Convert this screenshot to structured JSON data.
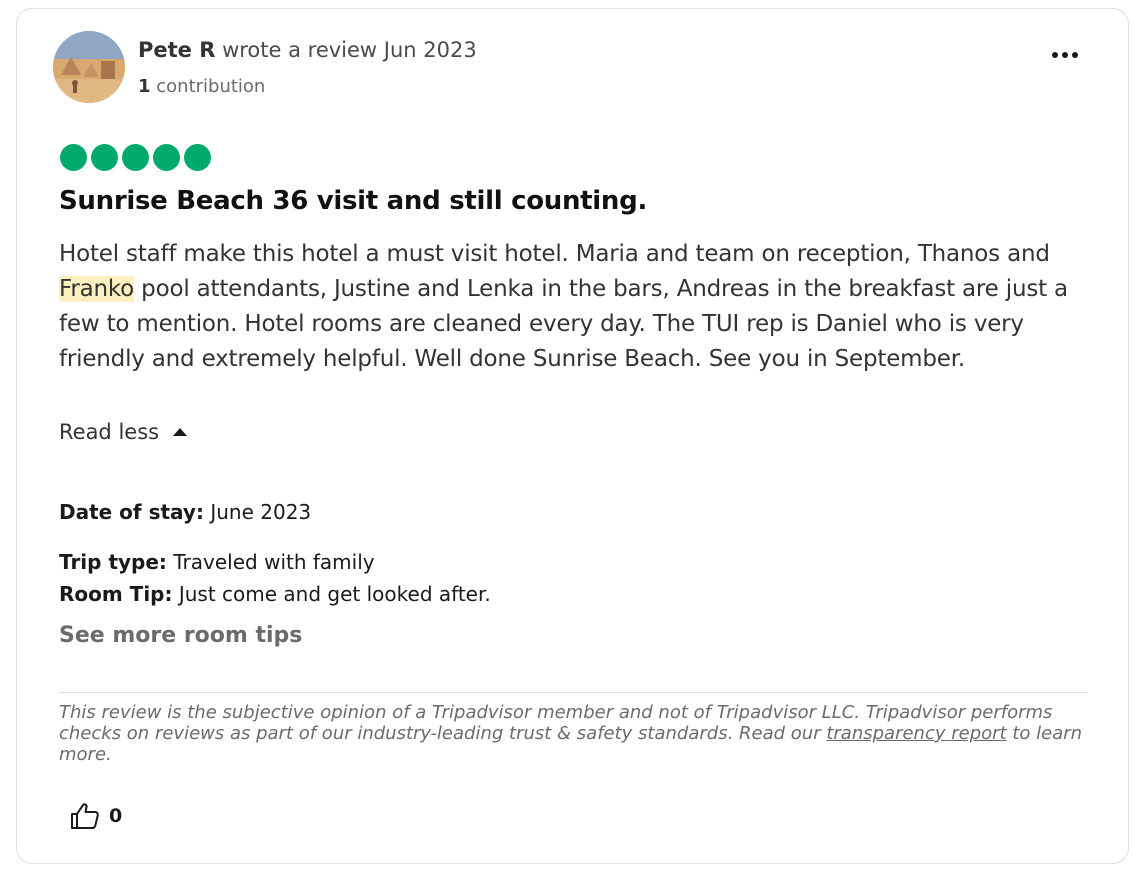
{
  "review": {
    "author_name": "Pete R",
    "author_action": " wrote a review Jun 2023",
    "contributions_count": "1",
    "contributions_label": " contribution",
    "rating": 5,
    "rating_max": 5,
    "rating_color": "#00aa6c",
    "title": "Sunrise Beach 36 visit and still counting.",
    "body_part1": "Hotel staff make this hotel a must visit hotel. Maria and team on reception, Thanos and ",
    "body_highlight": "Franko",
    "body_part2": " pool attendants, Justine and Lenka in the bars, Andreas in the breakfast are just a few to mention. Hotel rooms are cleaned every day. The TUI rep is Daniel who is very friendly and extremely helpful. Well done Sunrise Beach. See you in September.",
    "read_less_label": "Read less",
    "date_of_stay_label": "Date of stay:",
    "date_of_stay_value": " June 2023",
    "trip_type_label": "Trip type:",
    "trip_type_value": " Traveled with family",
    "room_tip_label": "Room Tip:",
    "room_tip_value": " Just come and get looked after.",
    "see_more_room_tips_label": "See more room tips",
    "disclaimer_part1": "This review is the subjective opinion of a Tripadvisor member and not of Tripadvisor LLC. Tripadvisor performs checks on reviews as part of our industry-leading trust & safety standards. Read our ",
    "disclaimer_link": "transparency report",
    "disclaimer_part2": " to learn more.",
    "helpful_votes": "0"
  },
  "icons": {
    "more": "more-options-icon",
    "caret": "caret-up-icon",
    "helpful": "thumbs-up-icon"
  },
  "colors": {
    "highlight": "#fdf0c0",
    "text_muted": "#6b6b6b"
  }
}
